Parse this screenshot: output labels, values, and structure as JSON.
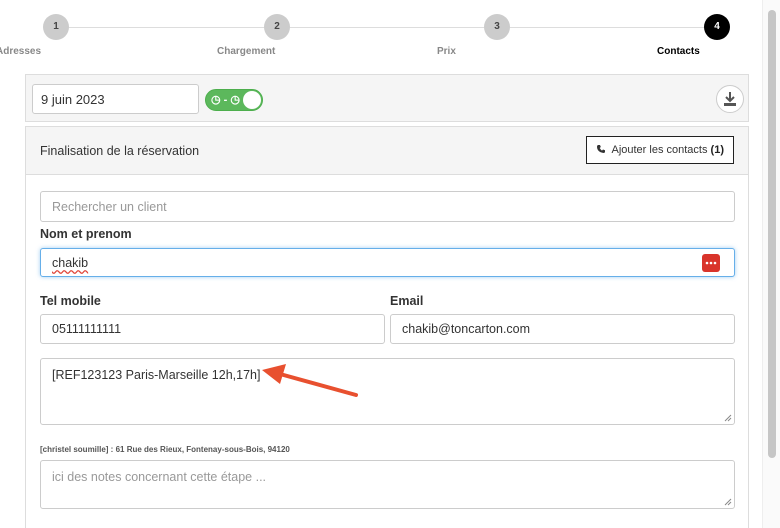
{
  "steps": [
    {
      "number": "1",
      "label": "Adresses"
    },
    {
      "number": "2",
      "label": "Chargement"
    },
    {
      "number": "3",
      "label": "Prix"
    },
    {
      "number": "4",
      "label": "Contacts"
    }
  ],
  "toolbar": {
    "date_value": "9 juin 2023",
    "toggle_label": "◷ - ◷"
  },
  "panel": {
    "title": "Finalisation de la réservation",
    "add_contacts_label": "Ajouter les contacts",
    "contacts_count": "(1)"
  },
  "form": {
    "search_placeholder": "Rechercher un client",
    "name_label": "Nom et prenom",
    "name_value": "chakib",
    "mobile_label": "Tel mobile",
    "mobile_value": "05111111111",
    "email_label": "Email",
    "email_value": "chakib@toncarton.com",
    "reference_value": "[REF123123 Paris-Marseille 12h,17h]",
    "address_line": "[christel soumille] : 61 Rue des Rieux, Fontenay-sous-Bois, 94120",
    "notes_placeholder": "ici des notes concernant cette étape ..."
  },
  "colors": {
    "accent_active": "#000000",
    "toggle_green": "#5cb85c",
    "annotation_arrow": "#e8502f",
    "password_icon": "#d9342b"
  },
  "icons": {
    "phone": "phone-icon",
    "download": "download-icon",
    "password_manager": "password-manager-icon"
  }
}
